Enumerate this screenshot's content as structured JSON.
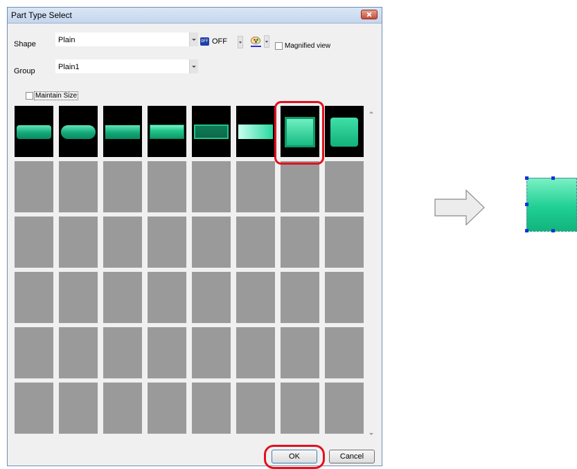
{
  "dialog": {
    "title": "Part Type Select",
    "shape_label": "Shape",
    "shape_value": "Plain",
    "off_text": "OFF",
    "off_icon_text": "OFF",
    "magnified_label": "Magnified view",
    "magnified_checked": false,
    "group_label": "Group",
    "group_value": "Plain1",
    "maintain_label": "Maintain Size",
    "maintain_checked": false,
    "ok_label": "OK",
    "cancel_label": "Cancel"
  },
  "grid": {
    "columns": 8,
    "rows": 6,
    "selected_index": 6,
    "parts": [
      "flat-rounded-bar",
      "pill-bar",
      "flat-bar",
      "beveled-bar",
      "dark-inset-bar",
      "gradient-bar",
      "square-beveled-selected",
      "square-rounded"
    ]
  },
  "colors": {
    "part_green": "#14a878",
    "highlight_red": "#e0111f",
    "empty_cell": "#9a9a9a",
    "handle_blue": "#1533d6"
  }
}
